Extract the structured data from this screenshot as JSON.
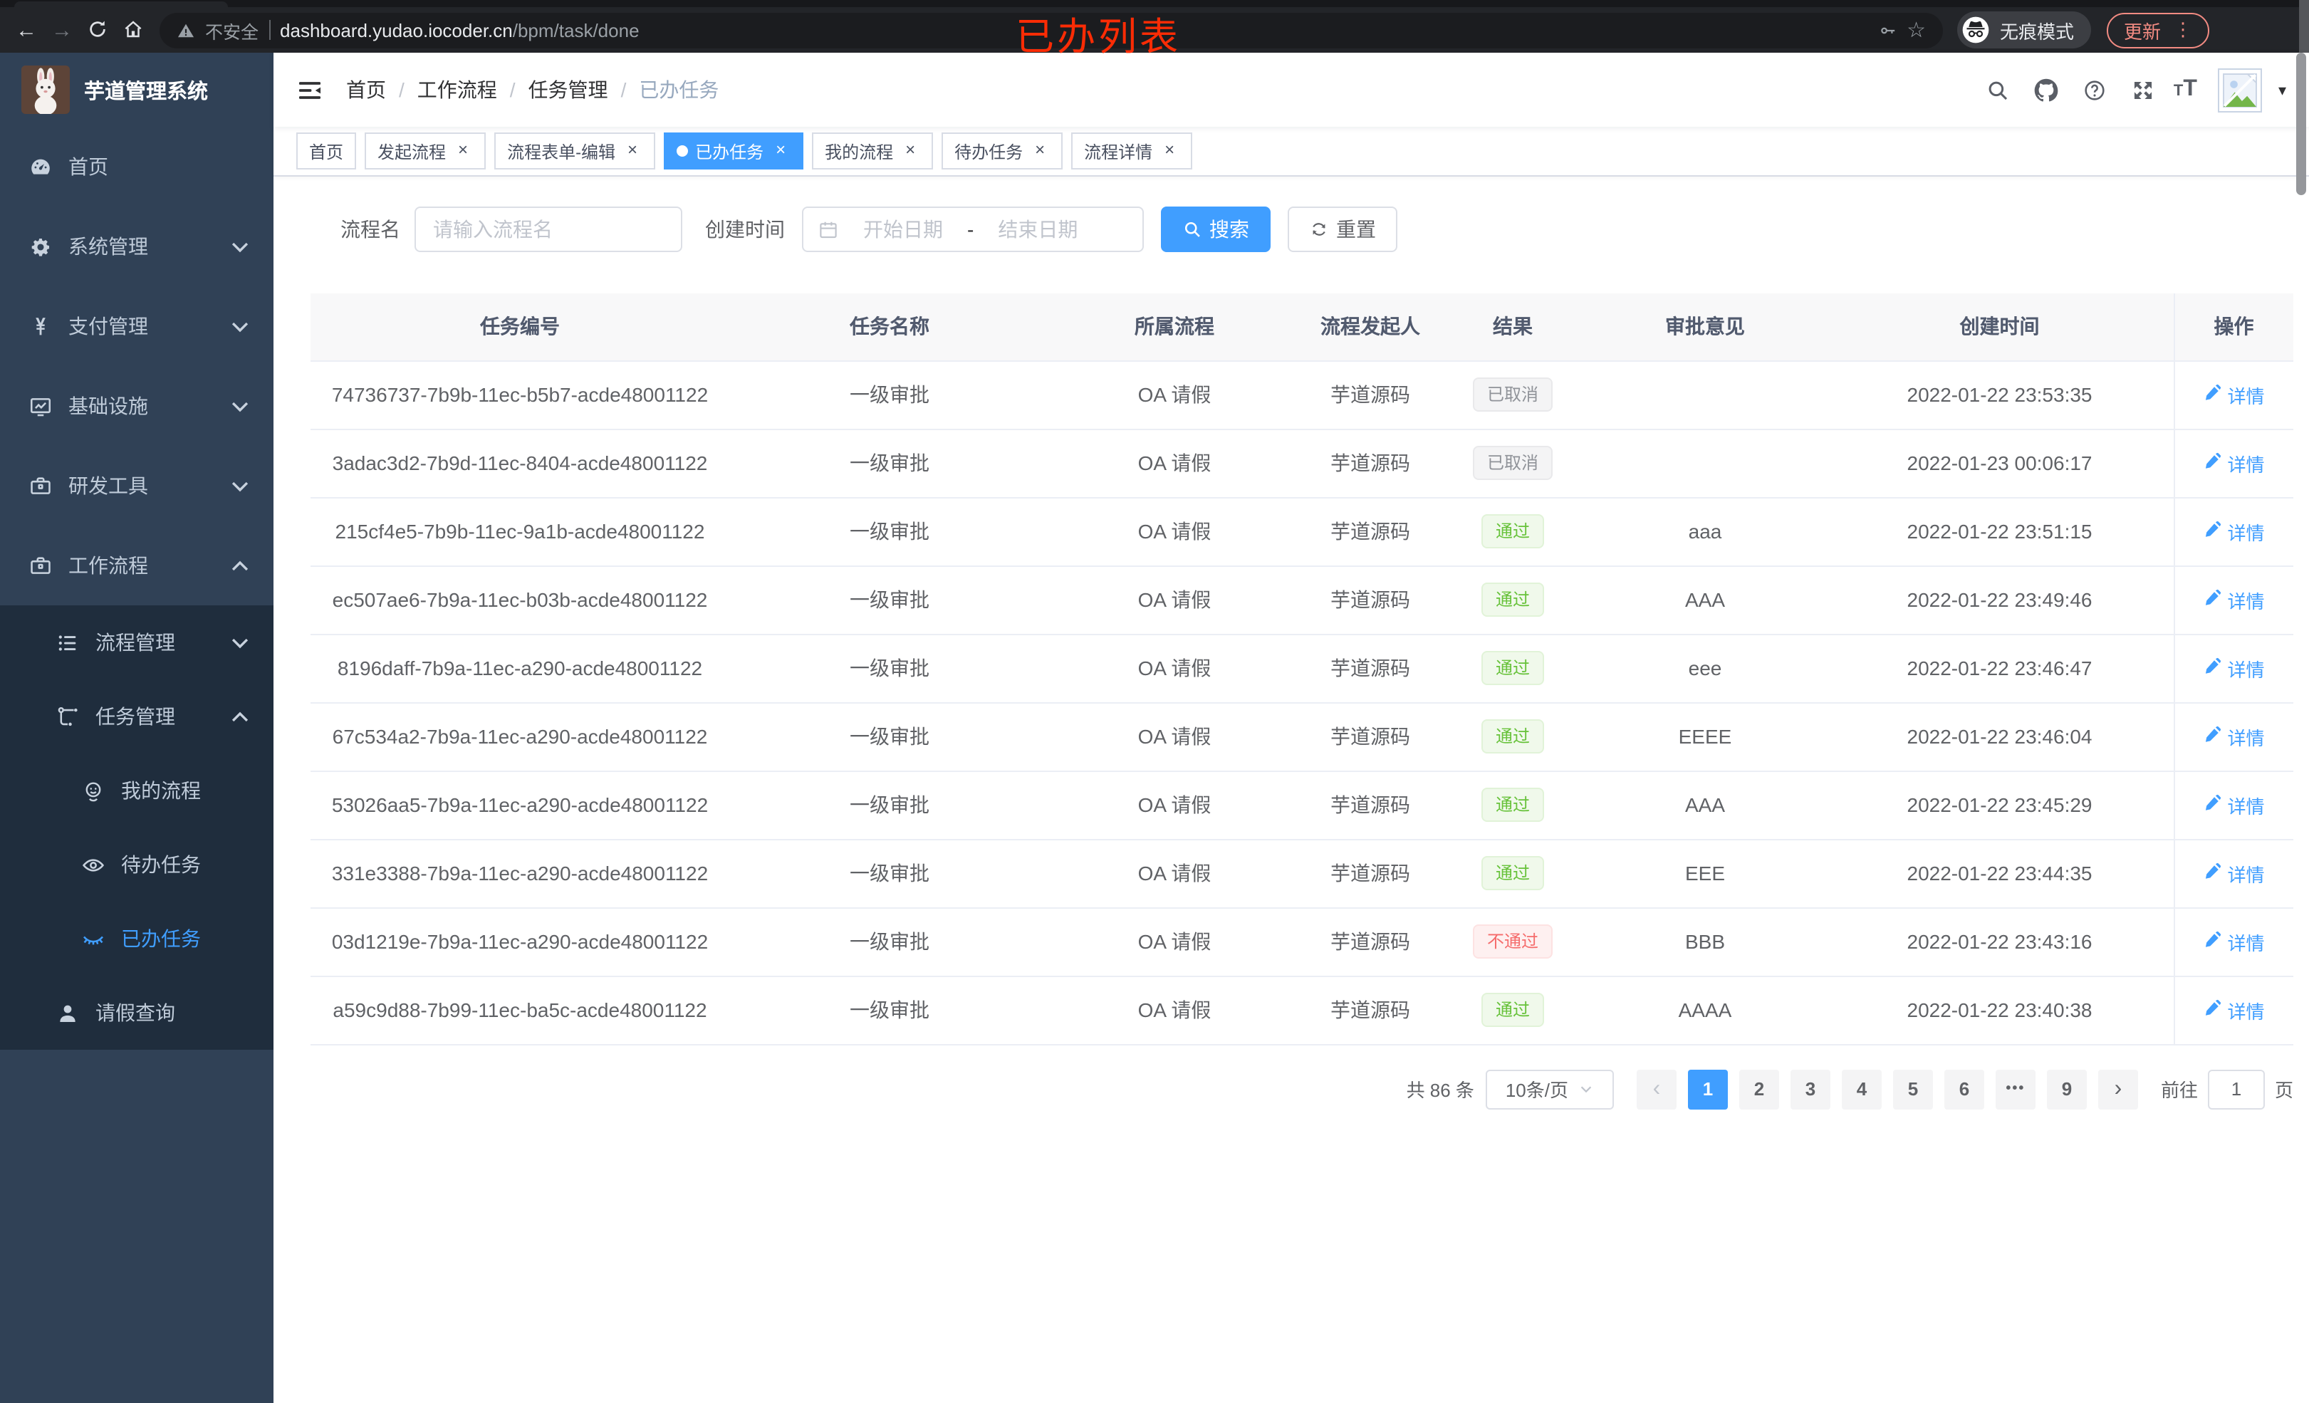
{
  "browser": {
    "security_text": "不安全",
    "url_host": "dashboard.yudao.iocoder.cn",
    "url_path": "/bpm/task/done",
    "annotation": "已办列表",
    "incognito_label": "无痕模式",
    "update_label": "更新"
  },
  "sidebar": {
    "app_title": "芋道管理系统",
    "items": [
      {
        "label": "首页",
        "icon": "dashboard-icon",
        "level": 1
      },
      {
        "label": "系统管理",
        "icon": "gear-icon",
        "level": 1,
        "chevron": "down"
      },
      {
        "label": "支付管理",
        "icon": "yen-icon",
        "level": 1,
        "chevron": "down"
      },
      {
        "label": "基础设施",
        "icon": "monitor-icon",
        "level": 1,
        "chevron": "down"
      },
      {
        "label": "研发工具",
        "icon": "briefcase-icon",
        "level": 1,
        "chevron": "down"
      },
      {
        "label": "工作流程",
        "icon": "briefcase-icon",
        "level": 1,
        "chevron": "up"
      },
      {
        "label": "流程管理",
        "icon": "list-icon",
        "level": 2,
        "chevron": "down",
        "submenu": true
      },
      {
        "label": "任务管理",
        "icon": "flow-tree-icon",
        "level": 2,
        "chevron": "up",
        "submenu": true
      },
      {
        "label": "我的流程",
        "icon": "robot-icon",
        "level": 3,
        "submenu": true
      },
      {
        "label": "待办任务",
        "icon": "eye-open-icon",
        "level": 3,
        "submenu": true
      },
      {
        "label": "已办任务",
        "icon": "eye-closed-icon",
        "level": 3,
        "submenu": true,
        "active": true
      },
      {
        "label": "请假查询",
        "icon": "user-icon",
        "level": 2,
        "submenu": true
      }
    ]
  },
  "header": {
    "breadcrumb": [
      "首页",
      "工作流程",
      "任务管理",
      "已办任务"
    ],
    "icons": [
      "search-icon",
      "github-icon",
      "question-icon",
      "fullscreen-icon"
    ]
  },
  "tabs": [
    {
      "label": "首页"
    },
    {
      "label": "发起流程",
      "closable": true
    },
    {
      "label": "流程表单-编辑",
      "closable": true
    },
    {
      "label": "已办任务",
      "closable": true,
      "active": true
    },
    {
      "label": "我的流程",
      "closable": true
    },
    {
      "label": "待办任务",
      "closable": true
    },
    {
      "label": "流程详情",
      "closable": true
    }
  ],
  "filters": {
    "name_label": "流程名",
    "name_placeholder": "请输入流程名",
    "time_label": "创建时间",
    "start_placeholder": "开始日期",
    "range_separator": "-",
    "end_placeholder": "结束日期",
    "search_label": "搜索",
    "reset_label": "重置"
  },
  "table": {
    "columns": [
      "任务编号",
      "任务名称",
      "所属流程",
      "流程发起人",
      "结果",
      "审批意见",
      "创建时间",
      "操作"
    ],
    "action_label": "详情",
    "rows": [
      {
        "id": "74736737-7b9b-11ec-b5b7-acde48001122",
        "name": "一级审批",
        "process": "OA 请假",
        "starter": "芋道源码",
        "result": "已取消",
        "result_type": "info",
        "comment": "",
        "time": "2022-01-22 23:53:35"
      },
      {
        "id": "3adac3d2-7b9d-11ec-8404-acde48001122",
        "name": "一级审批",
        "process": "OA 请假",
        "starter": "芋道源码",
        "result": "已取消",
        "result_type": "info",
        "comment": "",
        "time": "2022-01-23 00:06:17"
      },
      {
        "id": "215cf4e5-7b9b-11ec-9a1b-acde48001122",
        "name": "一级审批",
        "process": "OA 请假",
        "starter": "芋道源码",
        "result": "通过",
        "result_type": "success",
        "comment": "aaa",
        "time": "2022-01-22 23:51:15"
      },
      {
        "id": "ec507ae6-7b9a-11ec-b03b-acde48001122",
        "name": "一级审批",
        "process": "OA 请假",
        "starter": "芋道源码",
        "result": "通过",
        "result_type": "success",
        "comment": "AAA",
        "time": "2022-01-22 23:49:46"
      },
      {
        "id": "8196daff-7b9a-11ec-a290-acde48001122",
        "name": "一级审批",
        "process": "OA 请假",
        "starter": "芋道源码",
        "result": "通过",
        "result_type": "success",
        "comment": "eee",
        "time": "2022-01-22 23:46:47"
      },
      {
        "id": "67c534a2-7b9a-11ec-a290-acde48001122",
        "name": "一级审批",
        "process": "OA 请假",
        "starter": "芋道源码",
        "result": "通过",
        "result_type": "success",
        "comment": "EEEE",
        "time": "2022-01-22 23:46:04"
      },
      {
        "id": "53026aa5-7b9a-11ec-a290-acde48001122",
        "name": "一级审批",
        "process": "OA 请假",
        "starter": "芋道源码",
        "result": "通过",
        "result_type": "success",
        "comment": "AAA",
        "time": "2022-01-22 23:45:29"
      },
      {
        "id": "331e3388-7b9a-11ec-a290-acde48001122",
        "name": "一级审批",
        "process": "OA 请假",
        "starter": "芋道源码",
        "result": "通过",
        "result_type": "success",
        "comment": "EEE",
        "time": "2022-01-22 23:44:35"
      },
      {
        "id": "03d1219e-7b9a-11ec-a290-acde48001122",
        "name": "一级审批",
        "process": "OA 请假",
        "starter": "芋道源码",
        "result": "不通过",
        "result_type": "danger",
        "comment": "BBB",
        "time": "2022-01-22 23:43:16"
      },
      {
        "id": "a59c9d88-7b99-11ec-ba5c-acde48001122",
        "name": "一级审批",
        "process": "OA 请假",
        "starter": "芋道源码",
        "result": "通过",
        "result_type": "success",
        "comment": "AAAA",
        "time": "2022-01-22 23:40:38"
      }
    ]
  },
  "pagination": {
    "total_text": "共 86 条",
    "page_size": "10条/页",
    "pages": [
      "1",
      "2",
      "3",
      "4",
      "5",
      "6",
      "•••",
      "9"
    ],
    "active_page": "1",
    "prev_label": "‹",
    "next_label": "›",
    "goto_label": "前往",
    "goto_value": "1",
    "page_unit": "页"
  },
  "colors": {
    "accent": "#409eff",
    "success": "#67c23a",
    "danger": "#f56c6c",
    "info": "#909399",
    "sidebar_bg": "#304156",
    "submenu_bg": "#1f2d3d"
  }
}
